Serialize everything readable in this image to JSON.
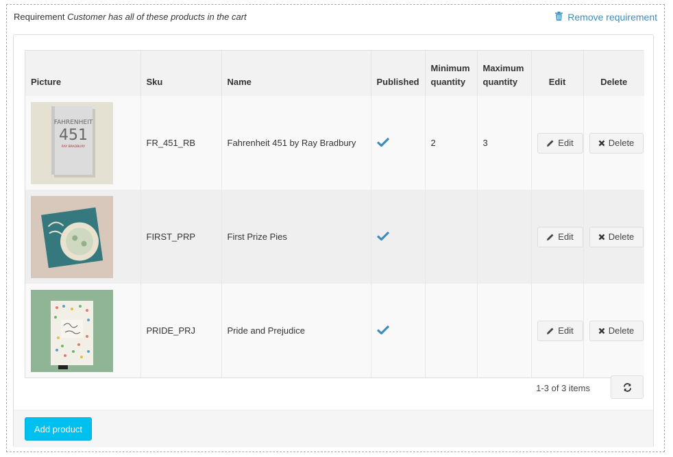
{
  "requirement": {
    "prefix": "Requirement",
    "condition": "Customer has all of these products in the cart",
    "remove_label": "Remove requirement"
  },
  "grid": {
    "headers": {
      "picture": "Picture",
      "sku": "Sku",
      "name": "Name",
      "published": "Published",
      "min_qty_1": "Minimum",
      "min_qty_2": "quantity",
      "max_qty_1": "Maximum",
      "max_qty_2": "quantity",
      "edit": "Edit",
      "delete": "Delete"
    },
    "rows": [
      {
        "picture": "book-cover-fahrenheit",
        "cover_title_1": "FAHRENHEIT",
        "cover_title_2": "451",
        "cover_author": "RAY BRADBURY",
        "sku": "FR_451_RB",
        "name": "Fahrenheit 451 by Ray Bradbury",
        "published": true,
        "min_qty": "2",
        "max_qty": "3",
        "edit_label": "Edit",
        "delete_label": "Delete"
      },
      {
        "picture": "book-cover-pies",
        "sku": "FIRST_PRP",
        "name": "First Prize Pies",
        "published": true,
        "min_qty": "",
        "max_qty": "",
        "edit_label": "Edit",
        "delete_label": "Delete"
      },
      {
        "picture": "book-cover-pride",
        "sku": "PRIDE_PRJ",
        "name": "Pride and Prejudice",
        "published": true,
        "min_qty": "",
        "max_qty": "",
        "edit_label": "Edit",
        "delete_label": "Delete"
      }
    ],
    "pager_info": "1-3 of 3 items"
  },
  "footer": {
    "add_label": "Add product"
  },
  "colors": {
    "accent": "#00c0ef",
    "link": "#3c8dbc",
    "check": "#3c8dbc"
  }
}
